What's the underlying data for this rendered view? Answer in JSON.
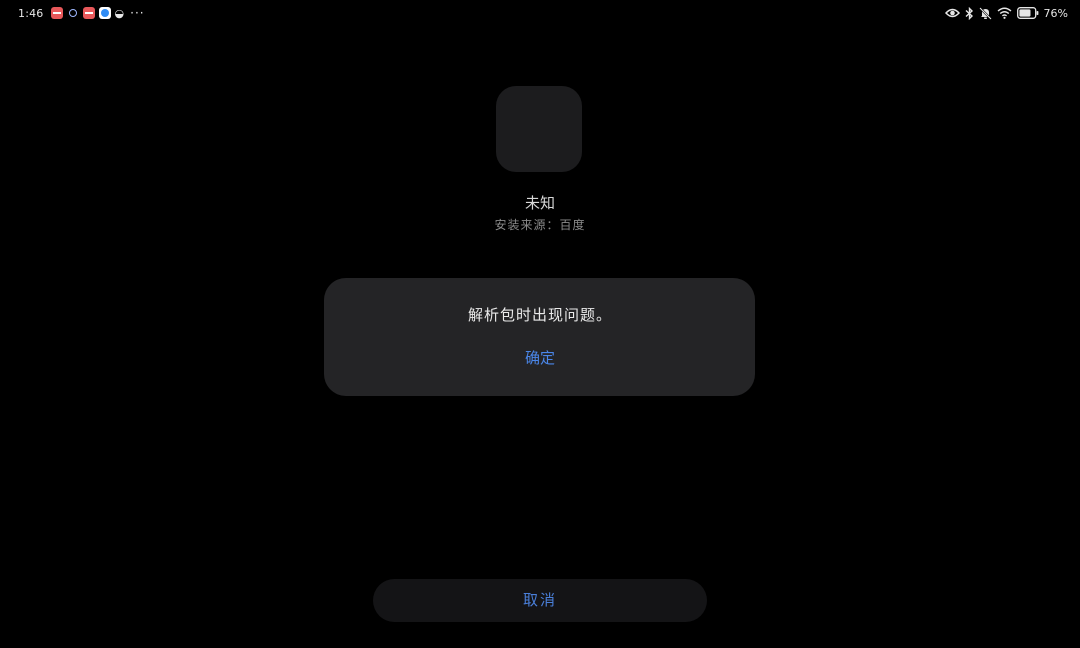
{
  "status_bar": {
    "time": "1:46",
    "battery_percent": "76%",
    "battery_level": 0.76,
    "icons": [
      "red-app-icon",
      "target-icon",
      "red-app-icon",
      "blue-app-icon",
      "wechat-icon",
      "more-icon",
      "eye-icon",
      "bluetooth-icon",
      "bell-muted-icon",
      "wifi-icon",
      "battery-icon"
    ],
    "more_glyph": "···",
    "wechat_glyph": "◒"
  },
  "app": {
    "name": "未知",
    "install_source": "安装来源：百度"
  },
  "dialog": {
    "message": "解析包时出现问题。",
    "confirm_label": "确定"
  },
  "footer": {
    "cancel_label": "取消"
  },
  "colors": {
    "background": "#000000",
    "dialog": "#242426",
    "accent": "#4a86e8"
  }
}
